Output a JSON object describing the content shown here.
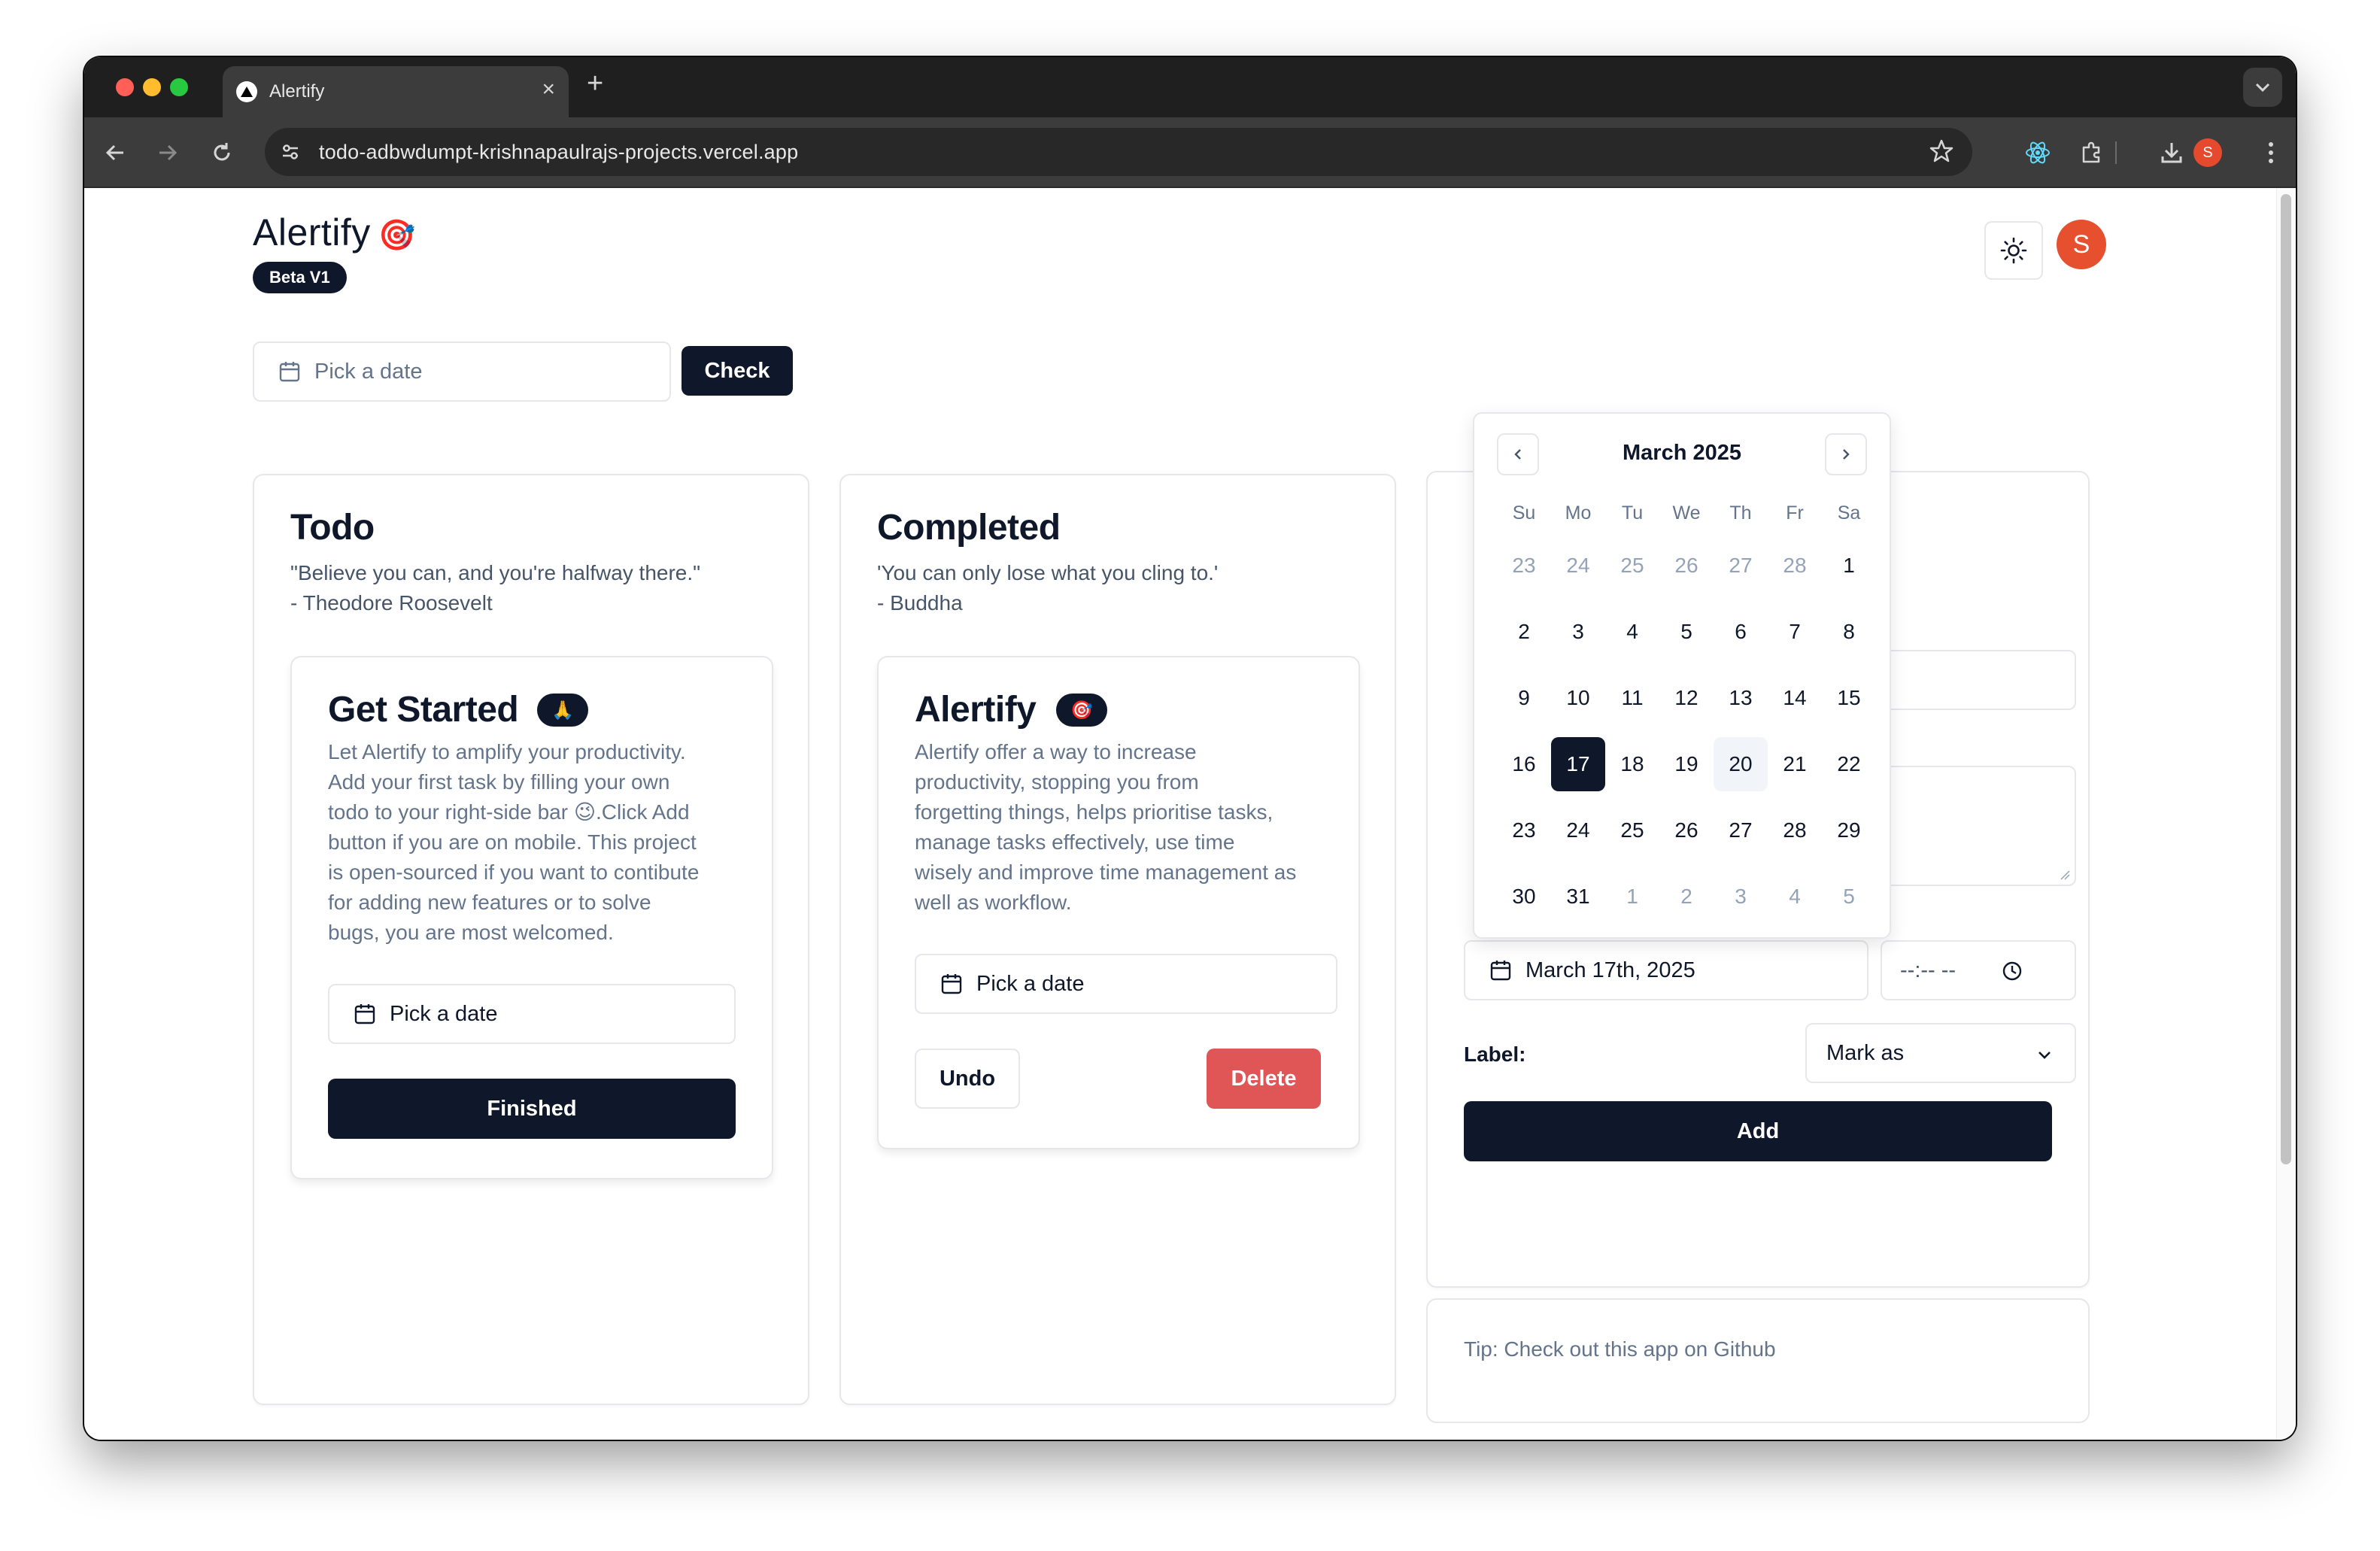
{
  "browser": {
    "tab_title": "Alertify",
    "url": "todo-adbwdumpt-krishnapaulrajs-projects.vercel.app",
    "profile_initial": "S"
  },
  "header": {
    "brand": "Alertify",
    "brand_emoji": "🎯",
    "badge": "Beta V1",
    "avatar_initial": "S"
  },
  "top_filter": {
    "date_placeholder": "Pick a date",
    "check_label": "Check"
  },
  "todo": {
    "title": "Todo",
    "quote_line1": "\"Believe you can, and you're halfway there.\"",
    "quote_line2": "- Theodore Roosevelt",
    "card": {
      "title": "Get Started",
      "emoji": "🙏",
      "body_lines": [
        "Let Alertify to amplify your productivity.",
        "Add your first task by filling your own",
        "todo to your right-side bar 😉.Click Add",
        "button if you are on mobile. This project",
        "is open-sourced if you want to contibute",
        "for adding new features or to solve",
        "bugs, you are most welcomed."
      ],
      "date_placeholder": "Pick a date",
      "finish_label": "Finished"
    }
  },
  "completed": {
    "title": "Completed",
    "quote_line1": "'You can only lose what you cling to.'",
    "quote_line2": "- Buddha",
    "card": {
      "title": "Alertify",
      "emoji": "🎯",
      "body_lines": [
        "Alertify offer a way to increase",
        "productivity, stopping you from",
        "forgetting things, helps prioritise tasks,",
        "manage tasks effectively, use time",
        "wisely and improve time management as",
        "well as workflow."
      ],
      "date_placeholder": "Pick a date",
      "undo_label": "Undo",
      "delete_label": "Delete"
    }
  },
  "add_form": {
    "date_value": "March 17th, 2025",
    "time_placeholder": "--:-- --",
    "label_text": "Label:",
    "label_select_value": "Mark as",
    "add_label": "Add"
  },
  "tip": {
    "text": "Tip: Check out this app on Github"
  },
  "calendar": {
    "month_label": "March 2025",
    "weekdays": [
      "Su",
      "Mo",
      "Tu",
      "We",
      "Th",
      "Fr",
      "Sa"
    ],
    "days": [
      {
        "d": "23",
        "outside": true
      },
      {
        "d": "24",
        "outside": true
      },
      {
        "d": "25",
        "outside": true
      },
      {
        "d": "26",
        "outside": true
      },
      {
        "d": "27",
        "outside": true
      },
      {
        "d": "28",
        "outside": true
      },
      {
        "d": "1"
      },
      {
        "d": "2"
      },
      {
        "d": "3"
      },
      {
        "d": "4"
      },
      {
        "d": "5"
      },
      {
        "d": "6"
      },
      {
        "d": "7"
      },
      {
        "d": "8"
      },
      {
        "d": "9"
      },
      {
        "d": "10"
      },
      {
        "d": "11"
      },
      {
        "d": "12"
      },
      {
        "d": "13"
      },
      {
        "d": "14"
      },
      {
        "d": "15"
      },
      {
        "d": "16"
      },
      {
        "d": "17",
        "selected": true
      },
      {
        "d": "18"
      },
      {
        "d": "19"
      },
      {
        "d": "20",
        "today": true
      },
      {
        "d": "21"
      },
      {
        "d": "22"
      },
      {
        "d": "23"
      },
      {
        "d": "24"
      },
      {
        "d": "25"
      },
      {
        "d": "26"
      },
      {
        "d": "27"
      },
      {
        "d": "28"
      },
      {
        "d": "29"
      },
      {
        "d": "30"
      },
      {
        "d": "31"
      },
      {
        "d": "1",
        "outside": true
      },
      {
        "d": "2",
        "outside": true
      },
      {
        "d": "3",
        "outside": true
      },
      {
        "d": "4",
        "outside": true
      },
      {
        "d": "5",
        "outside": true
      }
    ]
  },
  "colors": {
    "primary": "#0f172a",
    "danger": "#e05656",
    "avatar": "#e6502e",
    "muted_text": "#64748b",
    "border": "#e5e7eb"
  },
  "icons": {
    "calendar": "calendar-icon",
    "clock": "clock-icon",
    "sun": "sun-icon",
    "chevron": "chevron-down-icon"
  }
}
